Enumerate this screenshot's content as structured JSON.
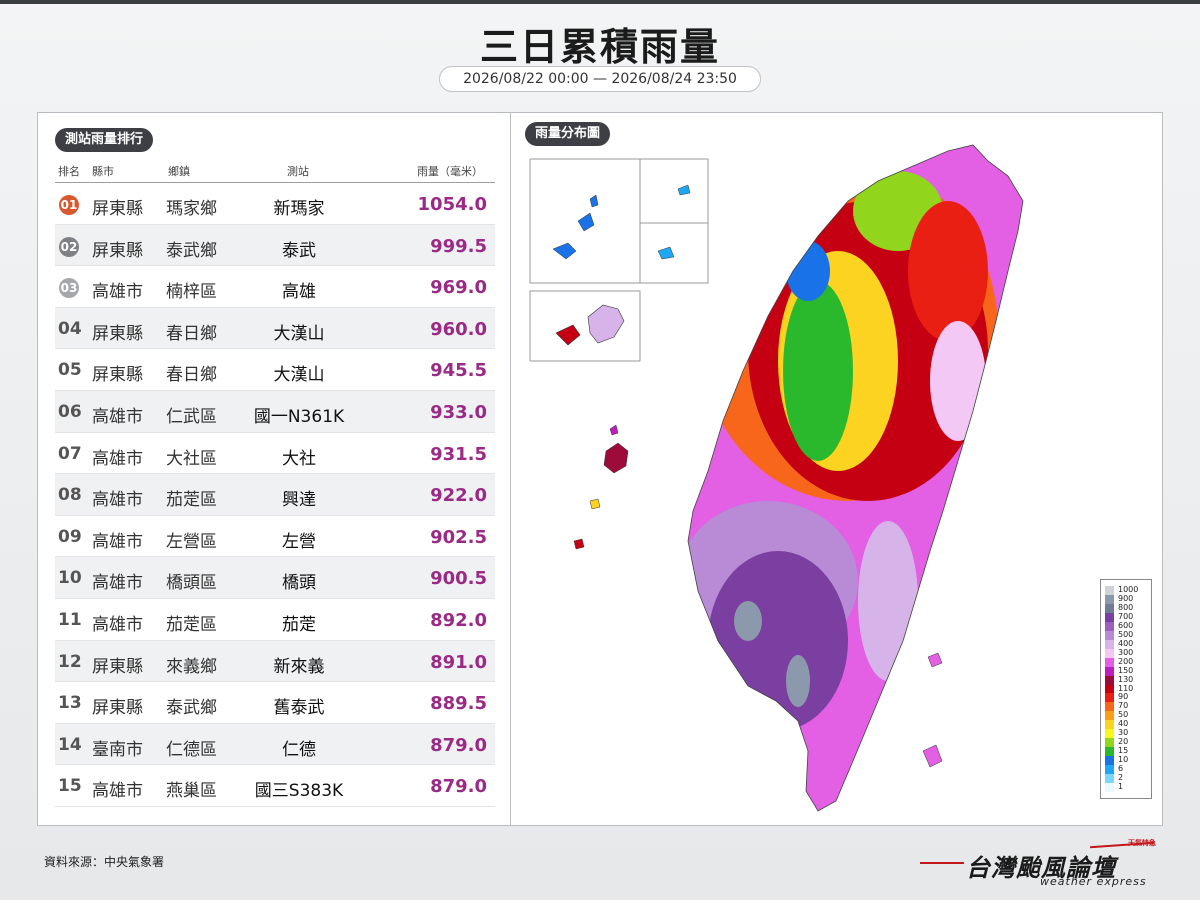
{
  "header": {
    "title": "三日累積雨量",
    "date_range": "2026/08/22 00:00 — 2026/08/24 23:50"
  },
  "ranking": {
    "title": "測站雨量排行",
    "columns": [
      "排名",
      "縣市",
      "鄉鎮",
      "測站",
      "雨量（毫米）"
    ],
    "badge_colors": [
      "#d8582f",
      "#7d8186",
      "#a4a8ac"
    ],
    "rows": [
      {
        "rank": "01",
        "county": "屏東縣",
        "town": "瑪家鄉",
        "station": "新瑪家",
        "rain": "1054.0"
      },
      {
        "rank": "02",
        "county": "屏東縣",
        "town": "泰武鄉",
        "station": "泰武",
        "rain": "999.5"
      },
      {
        "rank": "03",
        "county": "高雄市",
        "town": "楠梓區",
        "station": "高雄",
        "rain": "969.0"
      },
      {
        "rank": "04",
        "county": "屏東縣",
        "town": "春日鄉",
        "station": "大漢山",
        "rain": "960.0"
      },
      {
        "rank": "05",
        "county": "屏東縣",
        "town": "春日鄉",
        "station": "大漢山",
        "rain": "945.5"
      },
      {
        "rank": "06",
        "county": "高雄市",
        "town": "仁武區",
        "station": "國一N361K",
        "rain": "933.0"
      },
      {
        "rank": "07",
        "county": "高雄市",
        "town": "大社區",
        "station": "大社",
        "rain": "931.5"
      },
      {
        "rank": "08",
        "county": "高雄市",
        "town": "茄萣區",
        "station": "興達",
        "rain": "922.0"
      },
      {
        "rank": "09",
        "county": "高雄市",
        "town": "左營區",
        "station": "左營",
        "rain": "902.5"
      },
      {
        "rank": "10",
        "county": "高雄市",
        "town": "橋頭區",
        "station": "橋頭",
        "rain": "900.5"
      },
      {
        "rank": "11",
        "county": "高雄市",
        "town": "茄萣區",
        "station": "茄萣",
        "rain": "892.0"
      },
      {
        "rank": "12",
        "county": "屏東縣",
        "town": "來義鄉",
        "station": "新來義",
        "rain": "891.0"
      },
      {
        "rank": "13",
        "county": "屏東縣",
        "town": "泰武鄉",
        "station": "舊泰武",
        "rain": "889.5"
      },
      {
        "rank": "14",
        "county": "臺南市",
        "town": "仁德區",
        "station": "仁德",
        "rain": "879.0"
      },
      {
        "rank": "15",
        "county": "高雄市",
        "town": "燕巢區",
        "station": "國三S383K",
        "rain": "879.0"
      }
    ]
  },
  "map": {
    "title": "雨量分布圖",
    "legend": [
      {
        "label": "1000",
        "color": "#cfd3d8"
      },
      {
        "label": "900",
        "color": "#8c98ab"
      },
      {
        "label": "800",
        "color": "#6f7c93"
      },
      {
        "label": "700",
        "color": "#7a3fa0"
      },
      {
        "label": "600",
        "color": "#9c5fc0"
      },
      {
        "label": "500",
        "color": "#b98ad6"
      },
      {
        "label": "400",
        "color": "#d6b4ea"
      },
      {
        "label": "300",
        "color": "#f3c8f4"
      },
      {
        "label": "200",
        "color": "#e35fe3"
      },
      {
        "label": "150",
        "color": "#bb1fc0"
      },
      {
        "label": "130",
        "color": "#9c0b3a"
      },
      {
        "label": "110",
        "color": "#c50012"
      },
      {
        "label": "90",
        "color": "#ea1f13"
      },
      {
        "label": "70",
        "color": "#f7661a"
      },
      {
        "label": "50",
        "color": "#fb9f17"
      },
      {
        "label": "40",
        "color": "#fcd320"
      },
      {
        "label": "30",
        "color": "#f6f71b"
      },
      {
        "label": "20",
        "color": "#91d51d"
      },
      {
        "label": "15",
        "color": "#2ab82c"
      },
      {
        "label": "10",
        "color": "#1a72e8"
      },
      {
        "label": "6",
        "color": "#1fa7f4"
      },
      {
        "label": "2",
        "color": "#7ad8f7"
      },
      {
        "label": "1",
        "color": "#eaf8fd"
      }
    ]
  },
  "footer": {
    "source": "資料來源：中央氣象署",
    "logo_name": "台灣颱風論壇",
    "logo_sub": "weather express",
    "logo_tag": "天氣特急"
  }
}
